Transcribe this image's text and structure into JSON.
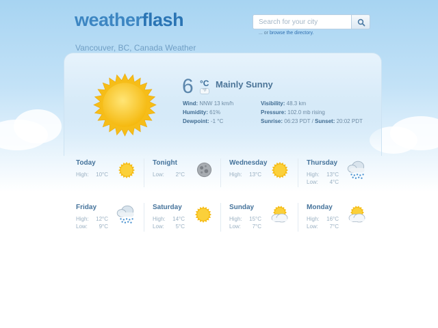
{
  "header": {
    "logo_part1": "weather",
    "logo_part2": "flash",
    "search_placeholder": "Search for your city",
    "directory_prefix": "... or ",
    "directory_link": "browse the directory."
  },
  "location_title": "Vancouver, BC, Canada Weather",
  "current": {
    "temperature": "6",
    "unit_c": "°C",
    "unit_f": "°F",
    "condition": "Mainly Sunny",
    "icon": "sun-icon",
    "wind_label": "Wind:",
    "wind_value": "NNW 13 km/h",
    "humidity_label": "Humidity:",
    "humidity_value": "61%",
    "dewpoint_label": "Dewpoint:",
    "dewpoint_value": "-1 °C",
    "visibility_label": "Visibility:",
    "visibility_value": "48.3 km",
    "pressure_label": "Pressure:",
    "pressure_value": "102.0 mb rising",
    "sunrise_label": "Sunrise:",
    "sunrise_value": "06:23 PDT /",
    "sunset_label": "Sunset:",
    "sunset_value": "20:02 PDT"
  },
  "forecast": [
    {
      "name": "Today",
      "rows": [
        {
          "label": "High:",
          "value": "10°C"
        }
      ],
      "icon": "sun-icon"
    },
    {
      "name": "Tonight",
      "rows": [
        {
          "label": "Low:",
          "value": "2°C"
        }
      ],
      "icon": "moon-icon"
    },
    {
      "name": "Wednesday",
      "rows": [
        {
          "label": "High:",
          "value": "13°C"
        }
      ],
      "icon": "sun-icon"
    },
    {
      "name": "Thursday",
      "rows": [
        {
          "label": "High:",
          "value": "13°C"
        },
        {
          "label": "Low:",
          "value": "4°C"
        }
      ],
      "icon": "snow-cloud-icon"
    },
    {
      "name": "Friday",
      "rows": [
        {
          "label": "High:",
          "value": "12°C"
        },
        {
          "label": "Low:",
          "value": "9°C"
        }
      ],
      "icon": "snow-cloud-icon"
    },
    {
      "name": "Saturday",
      "rows": [
        {
          "label": "High:",
          "value": "14°C"
        },
        {
          "label": "Low:",
          "value": "5°C"
        }
      ],
      "icon": "sun-icon"
    },
    {
      "name": "Sunday",
      "rows": [
        {
          "label": "High:",
          "value": "15°C"
        },
        {
          "label": "Low:",
          "value": "7°C"
        }
      ],
      "icon": "sun-cloud-icon"
    },
    {
      "name": "Monday",
      "rows": [
        {
          "label": "High:",
          "value": "16°C"
        },
        {
          "label": "Low:",
          "value": "7°C"
        }
      ],
      "icon": "sun-cloud-icon"
    }
  ],
  "colors": {
    "sky_top": "#a7d4f2",
    "brand_blue": "#2a74b4",
    "sun_yellow": "#f7c21f",
    "label_blue": "#3f6b91"
  }
}
